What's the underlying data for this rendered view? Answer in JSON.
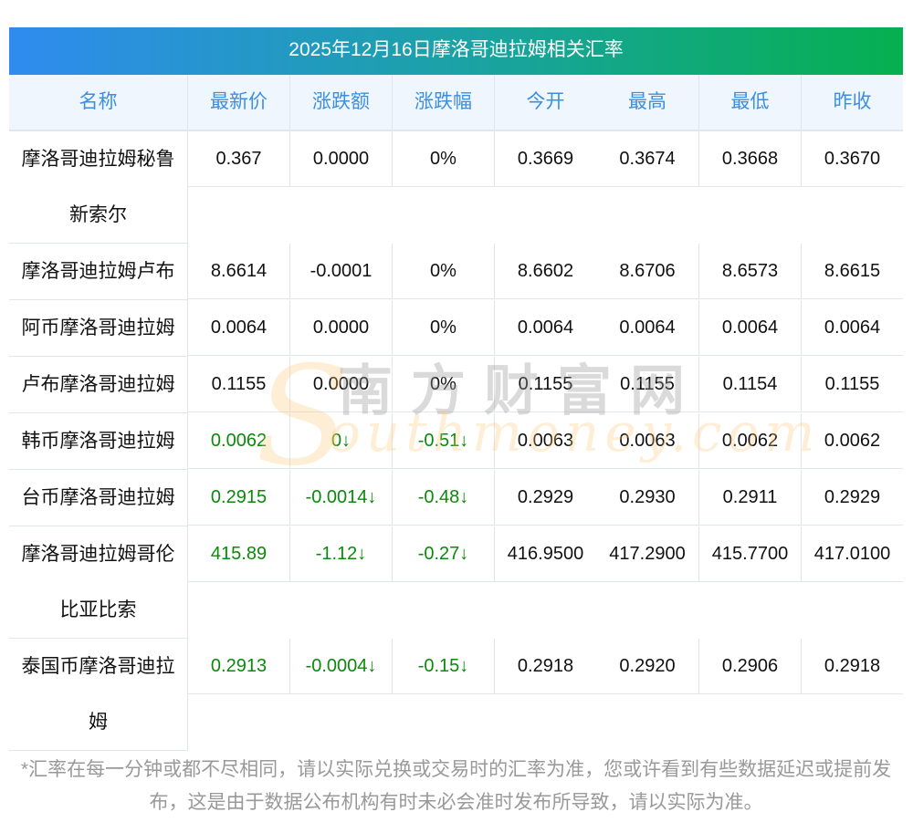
{
  "title": "2025年12月16日摩洛哥迪拉姆相关汇率",
  "headers": [
    "名称",
    "最新价",
    "涨跌额",
    "涨跌幅",
    "今开",
    "最高",
    "最低",
    "昨收"
  ],
  "rows": [
    {
      "name": "摩洛哥迪拉姆秘鲁新索尔",
      "values": [
        "0.367",
        "0.0000",
        "0%",
        "0.3669",
        "0.3674",
        "0.3668",
        "0.3670"
      ],
      "down": false
    },
    {
      "name": "摩洛哥迪拉姆卢布",
      "values": [
        "8.6614",
        "-0.0001",
        "0%",
        "8.6602",
        "8.6706",
        "8.6573",
        "8.6615"
      ],
      "down": false
    },
    {
      "name": "阿币摩洛哥迪拉姆",
      "values": [
        "0.0064",
        "0.0000",
        "0%",
        "0.0064",
        "0.0064",
        "0.0064",
        "0.0064"
      ],
      "down": false
    },
    {
      "name": "卢布摩洛哥迪拉姆",
      "values": [
        "0.1155",
        "0.0000",
        "0%",
        "0.1155",
        "0.1155",
        "0.1154",
        "0.1155"
      ],
      "down": false
    },
    {
      "name": "韩币摩洛哥迪拉姆",
      "values": [
        "0.0062",
        "0↓",
        "-0.51↓",
        "0.0063",
        "0.0063",
        "0.0062",
        "0.0062"
      ],
      "down": true
    },
    {
      "name": "台币摩洛哥迪拉姆",
      "values": [
        "0.2915",
        "-0.0014↓",
        "-0.48↓",
        "0.2929",
        "0.2930",
        "0.2911",
        "0.2929"
      ],
      "down": true
    },
    {
      "name": "摩洛哥迪拉姆哥伦比亚比索",
      "values": [
        "415.89",
        "-1.12↓",
        "-0.27↓",
        "416.9500",
        "417.2900",
        "415.7700",
        "417.0100"
      ],
      "down": true
    },
    {
      "name": "泰国币摩洛哥迪拉姆",
      "values": [
        "0.2913",
        "-0.0004↓",
        "-0.15↓",
        "0.2918",
        "0.2920",
        "0.2906",
        "0.2918"
      ],
      "down": true
    }
  ],
  "watermark": {
    "cn": "南方财富网",
    "en": "outhmoney.com",
    "s": "S"
  },
  "note": "*汇率在每一分钟或都不尽相同，请以实际兑换或交易时的汇率为准，您或许看到有些数据延迟或提前发布，这是由于数据公布机构有时未必会准时发布所导致，请以实际为准。",
  "colors": {
    "down": "#0a8a0a",
    "header_text": "#3b8fe3"
  }
}
